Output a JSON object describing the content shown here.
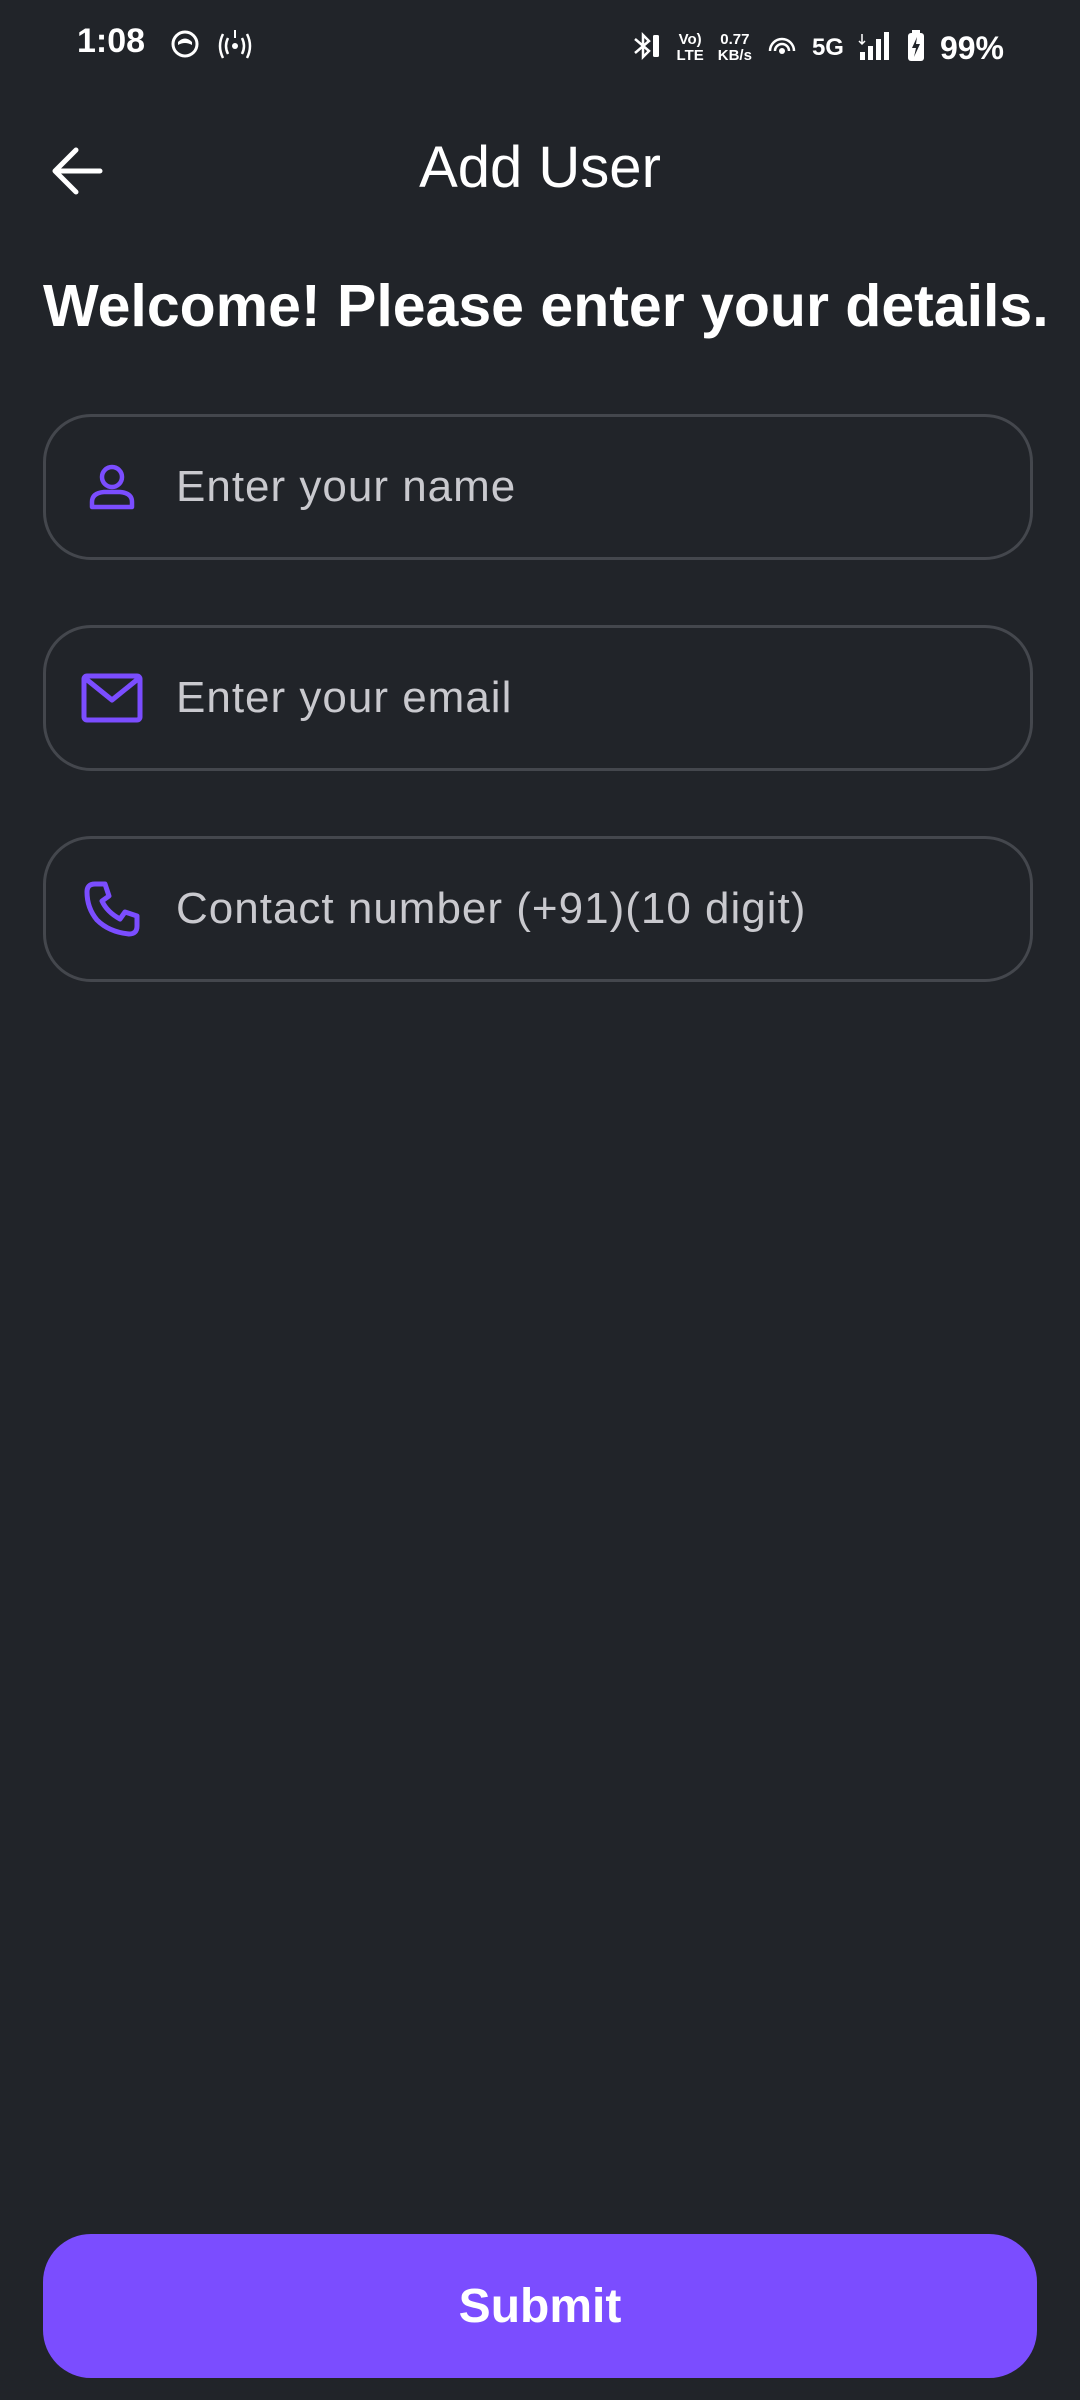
{
  "status_bar": {
    "time": "1:08",
    "volte_top": "Vo)",
    "volte_bottom": "LTE",
    "speed_value": "0.77",
    "speed_unit": "KB/s",
    "network": "5G",
    "battery": "99%"
  },
  "header": {
    "title": "Add User"
  },
  "welcome_text": "Welcome! Please enter your details.",
  "form": {
    "name_placeholder": "Enter your name",
    "email_placeholder": "Enter your email",
    "phone_placeholder": "Contact number (+91)(10 digit)",
    "submit_label": "Submit"
  },
  "colors": {
    "background": "#212429",
    "accent": "#7b4dff",
    "field_border": "#44474d"
  },
  "icons": {
    "back": "arrow-left-icon",
    "name": "person-icon",
    "email": "mail-icon",
    "phone": "phone-icon"
  }
}
